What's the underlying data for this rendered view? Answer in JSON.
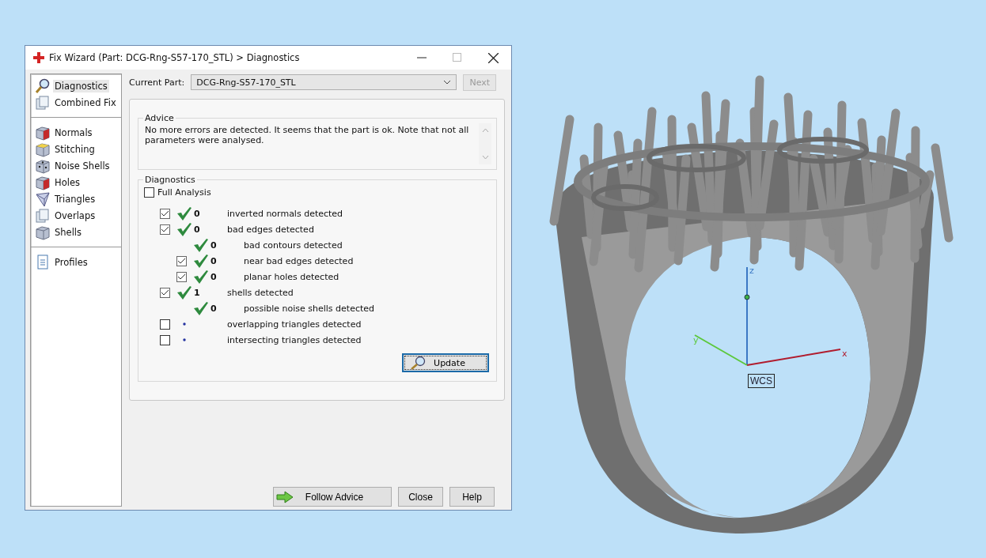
{
  "window": {
    "title": "Fix Wizard (Part: DCG-Rng-S57-170_STL) > Diagnostics"
  },
  "sidebar": {
    "groups": [
      [
        {
          "label": "Diagnostics",
          "selected": true
        },
        {
          "label": "Combined Fix",
          "selected": false
        }
      ],
      [
        {
          "label": "Normals",
          "selected": false
        },
        {
          "label": "Stitching",
          "selected": false
        },
        {
          "label": "Noise Shells",
          "selected": false
        },
        {
          "label": "Holes",
          "selected": false
        },
        {
          "label": "Triangles",
          "selected": false
        },
        {
          "label": "Overlaps",
          "selected": false
        },
        {
          "label": "Shells",
          "selected": false
        }
      ],
      [
        {
          "label": "Profiles",
          "selected": false
        }
      ]
    ]
  },
  "current_part": {
    "label": "Current Part:",
    "value": "DCG-Rng-S57-170_STL"
  },
  "next_button": {
    "label": "Next",
    "disabled": true
  },
  "advice": {
    "title": "Advice",
    "text": "No more errors are detected. It seems that the part is ok. Note that not all parameters were analysed."
  },
  "diagnostics": {
    "title": "Diagnostics",
    "full_analysis": {
      "label": "Full Analysis",
      "checked": false
    },
    "rows": [
      {
        "checked": true,
        "done": true,
        "count": "0",
        "label": "inverted normals detected"
      },
      {
        "checked": true,
        "done": true,
        "count": "0",
        "label": "bad edges detected",
        "children": [
          {
            "done": true,
            "count": "0",
            "label": "bad contours detected"
          },
          {
            "checked": true,
            "done": true,
            "count": "0",
            "label": "near bad edges detected"
          },
          {
            "checked": true,
            "done": true,
            "count": "0",
            "label": "planar holes detected"
          }
        ]
      },
      {
        "checked": true,
        "done": true,
        "count": "1",
        "label": "shells detected",
        "children": [
          {
            "done": true,
            "count": "0",
            "label": "possible noise shells detected"
          }
        ]
      },
      {
        "checked": false,
        "done": false,
        "label": "overlapping triangles detected"
      },
      {
        "checked": false,
        "done": false,
        "label": "intersecting triangles detected"
      }
    ],
    "update_button": "Update"
  },
  "buttons": [
    {
      "label": "Follow Advice",
      "kind": "advice"
    },
    {
      "label": "Close",
      "kind": "plain"
    },
    {
      "label": "Help",
      "kind": "plain"
    }
  ],
  "viewport": {
    "axes": {
      "z": "z",
      "x": "x",
      "y": "y"
    },
    "frame_label": "WCS"
  }
}
